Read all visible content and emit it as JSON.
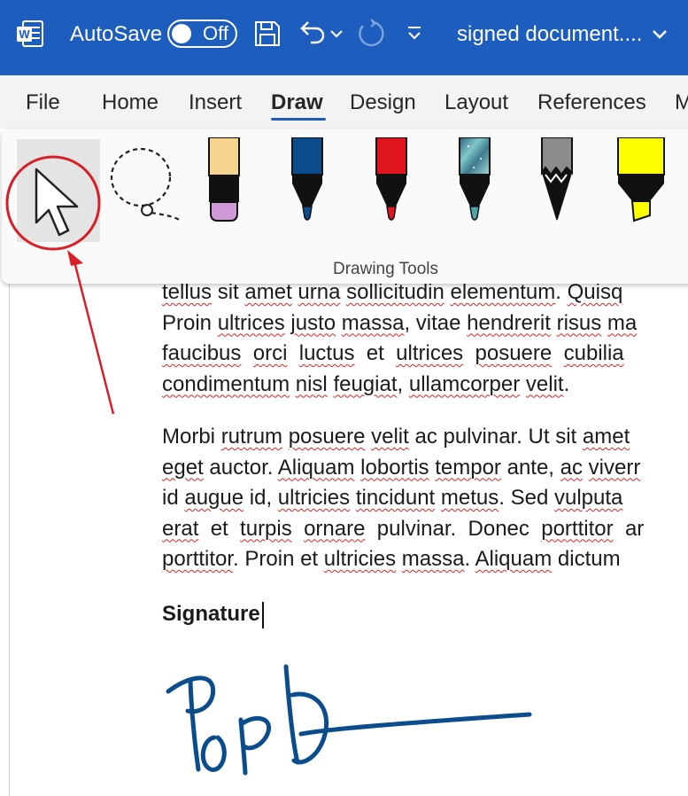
{
  "titlebar": {
    "autosave_label": "AutoSave",
    "autosave_state": "Off",
    "document_title": "signed document....",
    "background": "#1c5dbd",
    "icons": [
      "word-icon",
      "save-icon",
      "undo-icon",
      "chevron-down-icon",
      "redo-icon",
      "customize-toolbar-icon",
      "chevron-down-icon"
    ]
  },
  "tabs": [
    {
      "label": "File"
    },
    {
      "label": "Home"
    },
    {
      "label": "Insert"
    },
    {
      "label": "Draw",
      "active": true
    },
    {
      "label": "Design"
    },
    {
      "label": "Layout"
    },
    {
      "label": "References"
    },
    {
      "label": "M"
    }
  ],
  "ribbon": {
    "group_caption": "Drawing Tools",
    "tools": [
      {
        "name": "select-tool",
        "icon": "arrow-pointer-icon",
        "selected": true
      },
      {
        "name": "lasso-select-tool",
        "icon": "lasso-icon"
      },
      {
        "name": "pen-lavender",
        "icon": "pen-icon",
        "color": "#cf98d6",
        "cap": "#f5d48e"
      },
      {
        "name": "pen-blue",
        "icon": "pen-icon",
        "color": "#0b4d8c"
      },
      {
        "name": "pen-red",
        "icon": "pen-icon",
        "color": "#e0141e"
      },
      {
        "name": "pen-galaxy",
        "icon": "pen-icon",
        "color": "#4fa3a6"
      },
      {
        "name": "pencil-gray",
        "icon": "pencil-icon",
        "color": "#8b8b8b"
      },
      {
        "name": "highlighter-yellow",
        "icon": "highlighter-icon",
        "color": "#ffff00"
      }
    ]
  },
  "document": {
    "paragraphs": [
      {
        "lines": [
          [
            {
              "t": "tellus",
              "s": true
            },
            {
              "t": " sit "
            },
            {
              "t": "amet",
              "s": true
            },
            {
              "t": " "
            },
            {
              "t": "urna",
              "s": true
            },
            {
              "t": " "
            },
            {
              "t": "sollicitudin",
              "s": true
            },
            {
              "t": " "
            },
            {
              "t": "elementum",
              "s": true
            },
            {
              "t": ". "
            },
            {
              "t": "Quisq",
              "s": true
            }
          ],
          [
            {
              "t": "Proin "
            },
            {
              "t": "ultrices",
              "s": true
            },
            {
              "t": " "
            },
            {
              "t": "justo",
              "s": true
            },
            {
              "t": " "
            },
            {
              "t": "massa",
              "s": true
            },
            {
              "t": ", vitae "
            },
            {
              "t": "hendrerit",
              "s": true
            },
            {
              "t": " "
            },
            {
              "t": "risus",
              "s": true
            },
            {
              "t": " "
            },
            {
              "t": "ma",
              "s": true
            }
          ],
          [
            {
              "t": "faucibus",
              "s": true
            },
            {
              "t": "  "
            },
            {
              "t": "orci",
              "s": true
            },
            {
              "t": "  "
            },
            {
              "t": "luctus",
              "s": true
            },
            {
              "t": "  et  "
            },
            {
              "t": "ultrices",
              "s": true
            },
            {
              "t": "  "
            },
            {
              "t": "posuere",
              "s": true
            },
            {
              "t": "  "
            },
            {
              "t": "cubilia",
              "s": true
            }
          ],
          [
            {
              "t": "condimentum",
              "s": true
            },
            {
              "t": " "
            },
            {
              "t": "nisl",
              "s": true
            },
            {
              "t": " "
            },
            {
              "t": "feugiat",
              "s": true
            },
            {
              "t": ", "
            },
            {
              "t": "ullamcorper",
              "s": true
            },
            {
              "t": " "
            },
            {
              "t": "velit",
              "s": true
            },
            {
              "t": "."
            }
          ]
        ]
      },
      {
        "lines": [
          [
            {
              "t": "Morbi "
            },
            {
              "t": "rutrum",
              "s": true
            },
            {
              "t": " "
            },
            {
              "t": "posuere",
              "s": true
            },
            {
              "t": " "
            },
            {
              "t": "velit",
              "s": true
            },
            {
              "t": " ac pulvinar. Ut sit "
            },
            {
              "t": "amet",
              "s": true
            }
          ],
          [
            {
              "t": "eget",
              "s": true
            },
            {
              "t": " auctor. "
            },
            {
              "t": "Aliquam",
              "s": true
            },
            {
              "t": " "
            },
            {
              "t": "lobortis",
              "s": true
            },
            {
              "t": " "
            },
            {
              "t": "tempor",
              "s": true
            },
            {
              "t": " ante, "
            },
            {
              "t": "ac",
              "s": true
            },
            {
              "t": " "
            },
            {
              "t": "viverr",
              "s": true
            }
          ],
          [
            {
              "t": "id "
            },
            {
              "t": "augue",
              "s": true
            },
            {
              "t": " id, "
            },
            {
              "t": "ultricies",
              "s": true
            },
            {
              "t": " "
            },
            {
              "t": "tincidunt",
              "s": true
            },
            {
              "t": " "
            },
            {
              "t": "metus",
              "s": true
            },
            {
              "t": ". Sed "
            },
            {
              "t": "vulputa",
              "s": true
            }
          ],
          [
            {
              "t": "erat",
              "s": true
            },
            {
              "t": "  et  "
            },
            {
              "t": "turpis",
              "s": true
            },
            {
              "t": "  "
            },
            {
              "t": "ornare",
              "s": true
            },
            {
              "t": "  pulvinar.  Donec  "
            },
            {
              "t": "porttitor",
              "s": true
            },
            {
              "t": "  ar"
            }
          ],
          [
            {
              "t": "porttitor",
              "s": true
            },
            {
              "t": ". Proin et "
            },
            {
              "t": "ultricies",
              "s": true
            },
            {
              "t": " "
            },
            {
              "t": "massa",
              "s": true
            },
            {
              "t": ". "
            },
            {
              "t": "Aliquam",
              "s": true
            },
            {
              "t": " dictum "
            }
          ]
        ]
      }
    ],
    "signature_label": "Signature",
    "signature_ink_color": "#0b4d8c"
  },
  "annotation": {
    "color": "#d61f26"
  }
}
